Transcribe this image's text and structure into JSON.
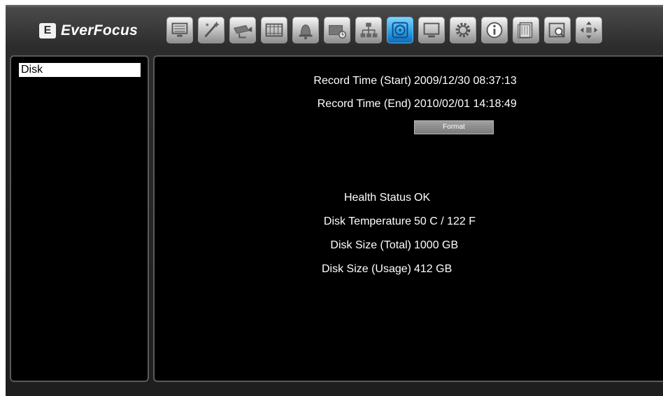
{
  "brand": {
    "logo_letter": "E",
    "name": "EverFocus"
  },
  "toolbar": {
    "icons": [
      "monitor-icon",
      "wizard-icon",
      "camera-icon",
      "film-icon",
      "alarm-icon",
      "hdd-schedule-icon",
      "network-icon",
      "disk-icon",
      "display-icon",
      "settings-gear-icon",
      "info-icon",
      "playback-icon",
      "search-icon",
      "ptz-arrows-icon"
    ],
    "active": "disk-icon",
    "active_color": "#2a9ae0"
  },
  "sidebar": {
    "items": [
      {
        "label": "Disk"
      }
    ]
  },
  "disk": {
    "record_start_label": "Record Time (Start)",
    "record_start_value": "2009/12/30 08:37:13",
    "record_end_label": "Record Time (End)",
    "record_end_value": "2010/02/01 14:18:49",
    "format_label": "Format",
    "health_label": "Health Status",
    "health_value": "OK",
    "temp_label": "Disk Temperature",
    "temp_value": "50 C / 122 F",
    "size_total_label": "Disk Size (Total)",
    "size_total_value": "1000 GB",
    "size_usage_label": "Disk Size (Usage)",
    "size_usage_value": "412 GB"
  }
}
